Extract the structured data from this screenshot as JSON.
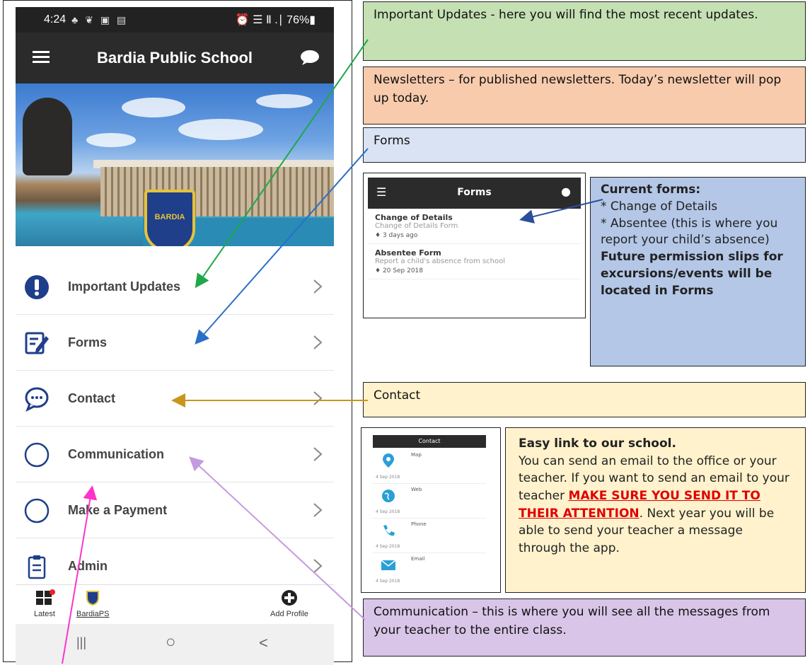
{
  "phone": {
    "status_bar": {
      "time": "4:24",
      "icons": "♣ ❦ ▣ ▤",
      "battery": "⏰ ☰ Ⅱ .∣ 76%▮"
    },
    "header": {
      "title": "Bardia Public School"
    },
    "hero": {
      "crest_text": "BARDIA"
    },
    "menu_items": [
      {
        "label": "Important Updates",
        "icon": "exclamation-icon"
      },
      {
        "label": "Forms",
        "icon": "pencil-form-icon"
      },
      {
        "label": "Contact",
        "icon": "chat-bubble-icon"
      },
      {
        "label": "Communication",
        "icon": "circle-icon"
      },
      {
        "label": "Make a Payment",
        "icon": "circle-icon"
      },
      {
        "label": "Admin",
        "icon": "clipboard-icon"
      }
    ],
    "bottom_nav": {
      "latest": "Latest",
      "profile": "BardiaPS",
      "add_profile": "Add Profile"
    },
    "system_nav": {
      "recents": "|||",
      "home": "○",
      "back": "<"
    }
  },
  "callouts": {
    "important_updates": "Important Updates - here you will find the most recent updates.",
    "newsletters": "Newsletters – for published newsletters. Today’s newsletter will pop up today.",
    "forms": "Forms",
    "contact": "Contact",
    "communication": "Communication – this is where you will see all the messages from your teacher to the entire class."
  },
  "forms_screenshot": {
    "title": "Forms",
    "items": [
      {
        "title": "Change of Details",
        "subtitle": "Change of Details Form",
        "date": "3 days ago"
      },
      {
        "title": "Absentee Form",
        "subtitle": "Report a child's absence from school",
        "date": "20 Sep 2018"
      }
    ]
  },
  "forms_info": {
    "heading": "Current forms:",
    "item1": "* Change of Details",
    "item2": "* Absentee (this is where you report your child’s absence)",
    "footer": "Future permission slips for excursions/events will be located in Forms"
  },
  "contact_screenshot": {
    "title": "Contact",
    "items": [
      "Map",
      "Web",
      "Phone",
      "Email"
    ],
    "date": "4 Sep 2018"
  },
  "contact_info": {
    "heading": "Easy link to our school.",
    "line1": "You can send an email to the office or your teacher.  If you want to send an email to your teacher",
    "warning": "MAKE SURE YOU SEND IT TO THEIR ATTENTION",
    "line2": ". Next year you will be able to send your teacher a message through the app."
  },
  "colors": {
    "green_box": "#c5e0b3",
    "peach_box": "#f8cbad",
    "blue_box": "#dae3f3",
    "yellow_box": "#fff2cc",
    "purple_box": "#d9c5e8",
    "info_blue": "#b4c7e7",
    "icon_blue": "#1f3f8a",
    "warning_red": "#e00000"
  }
}
